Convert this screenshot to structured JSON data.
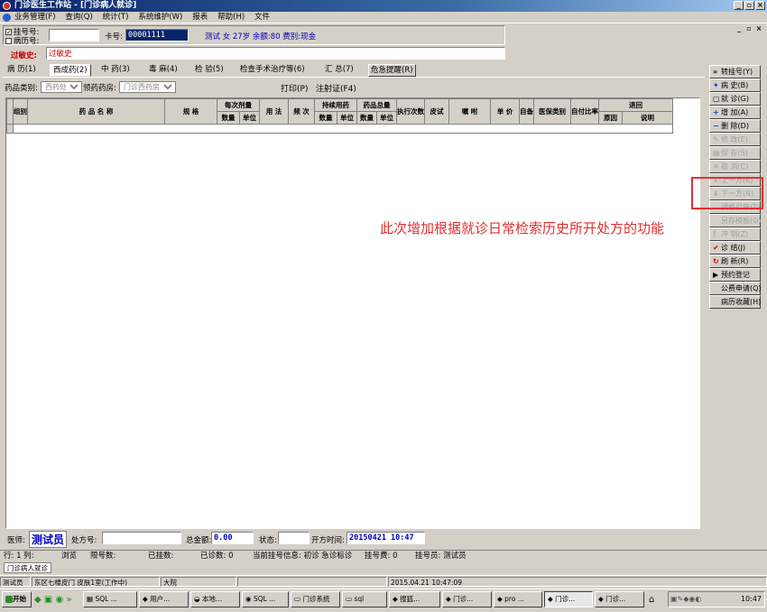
{
  "window": {
    "title": "门诊医生工作站 - [门诊病人就诊]"
  },
  "menu": [
    "业务管理(F)",
    "查询(Q)",
    "统计(T)",
    "系统维护(W)",
    "报表",
    "帮助(H)",
    "文件"
  ],
  "patient": {
    "reg_no_label": "挂号号:",
    "record_no_label": "病历号:",
    "reg_no_value": "",
    "card_label": "卡号:",
    "card_value": "00001111",
    "info": "测试 女 27岁 余额:80 费别:现金"
  },
  "allergy": {
    "label": "过敏史:",
    "value": "过敏史"
  },
  "tabs": [
    "病 历(1)",
    "西成药(2)",
    "中 药(3)",
    "毒 麻(4)",
    "检 验(5)",
    "检查手术治疗等(6)",
    "汇 总(7)",
    "危急提醒(R)"
  ],
  "toolbar": {
    "drug_type_label": "药品类别:",
    "drug_type_value": "西药处方",
    "pharmacy_label": "领药药房:",
    "pharmacy_value": "门诊西药房",
    "print_btn": "打印(P)",
    "inject_btn": "注射证(F4)"
  },
  "grid": {
    "headers": {
      "group": "组别",
      "name": "药 品 名 称",
      "spec": "规 格",
      "per_dose": "每次剂量",
      "qty": "数量",
      "unit": "单位",
      "usage": "用 法",
      "freq": "频 次",
      "cont_days": "持续用药",
      "total": "药品总量",
      "exec": "执行次数",
      "skin": "皮试",
      "advice": "嘱 咐",
      "price": "单 价",
      "mark": "自备",
      "insurance": "医保类别",
      "selfpay": "自付比率",
      "return": "退回",
      "reason": "原因",
      "note": "说明"
    }
  },
  "side_buttons": [
    {
      "label": "转挂号(Y)",
      "icon": "»",
      "enabled": true
    },
    {
      "label": "病 史(B)",
      "icon": "✦",
      "enabled": true
    },
    {
      "label": "就 诊(G)",
      "icon": "▢",
      "enabled": true
    },
    {
      "label": "增 加(A)",
      "icon": "+",
      "enabled": true
    },
    {
      "label": "删 除(D)",
      "icon": "−",
      "enabled": true
    },
    {
      "label": "修 改(E)",
      "icon": "✎",
      "enabled": false
    },
    {
      "label": "保 存(S)",
      "icon": "▤",
      "enabled": false
    },
    {
      "label": "取 消(C)",
      "icon": "✕",
      "enabled": false
    },
    {
      "label": "上一方(K)",
      "icon": "⇑",
      "enabled": false
    },
    {
      "label": "下一方(N)",
      "icon": "⇓",
      "enabled": false
    },
    {
      "label": "调格引单(T)",
      "icon": "",
      "enabled": false
    },
    {
      "label": "另存模板(O)",
      "icon": "",
      "enabled": false
    },
    {
      "label": "冲 销(Z)",
      "icon": "!",
      "enabled": false
    },
    {
      "label": "诊 结(J)",
      "icon": "✔",
      "enabled": true
    },
    {
      "label": "刷 新(R)",
      "icon": "↻",
      "enabled": true
    },
    {
      "label": "预约登记",
      "icon": "▶",
      "enabled": true
    },
    {
      "label": "公费申请(Q)",
      "icon": "",
      "enabled": true
    },
    {
      "label": "病历收藏(H)",
      "icon": "",
      "enabled": true
    }
  ],
  "annotation": "此次增加根据就诊日常检索历史所开处方的功能",
  "bottom": {
    "doctor_label": "医师:",
    "doctor": "测试员",
    "rx_label": "处方号:",
    "total_label": "总金额:",
    "total": "0.00",
    "status_label": "状态:",
    "time_label": "开方时间:",
    "time": "20150421 10:47"
  },
  "status1": [
    "行: 1 列:",
    "浏览",
    "限号数:",
    "已挂数:",
    "已诊数: 0",
    "当前挂号信息: 初诊 急诊标诊",
    "挂号费: 0",
    "挂号员: 测试员"
  ],
  "status2_tab": "门诊病人就诊",
  "status3": [
    "测试员",
    "东区七楼皮门 皮肤1室(工作中)",
    "大院",
    "",
    "2015.04.21 10:47:09"
  ],
  "taskbar": {
    "start": "开始",
    "items": [
      "SQL ...",
      "用户...",
      "本地...",
      "SQL ...",
      "门诊系统",
      "sql",
      "搜狐...",
      "门诊...",
      "pro ...",
      "门诊...",
      "门诊..."
    ],
    "clock": "10:47"
  },
  "colors": {
    "accent_red": "#e03030",
    "title_blue": "#0a246a"
  }
}
